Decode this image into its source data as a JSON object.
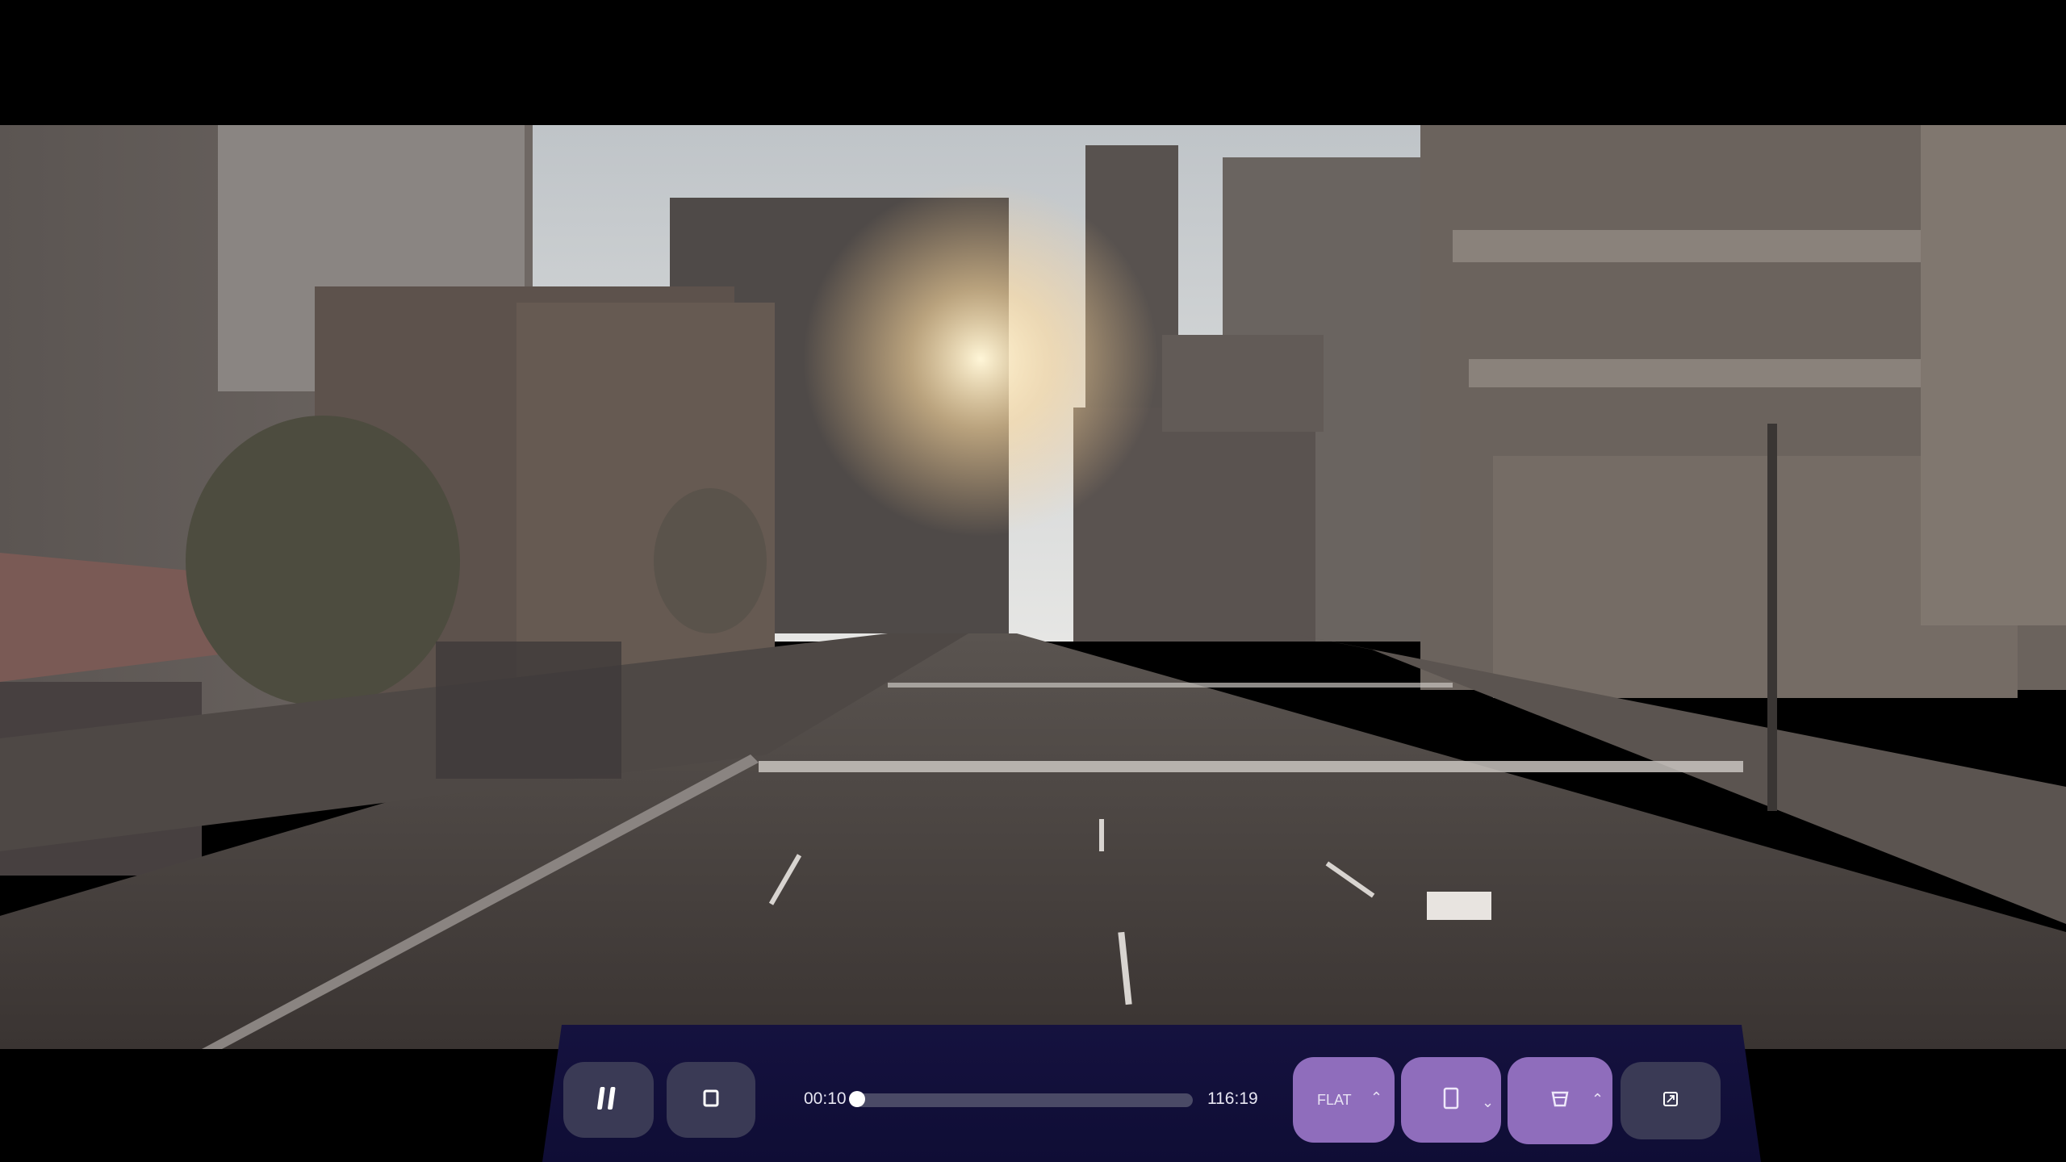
{
  "player": {
    "current_time": "00:10",
    "total_time": "116:19",
    "progress": 0.0014,
    "mode_label": "FLAT",
    "icons": {
      "pause": "pause-icon",
      "stop": "stop-icon",
      "screen_shape": "screen-shape-icon",
      "cinema": "theater-icon",
      "fullscreen": "resize-icon"
    },
    "colors": {
      "bar_bg": "#120f3b",
      "button_gray": "#3a3a55",
      "button_purple": "#8f6dbc",
      "track": "#4a4a66",
      "thumb": "#ffffff"
    }
  }
}
